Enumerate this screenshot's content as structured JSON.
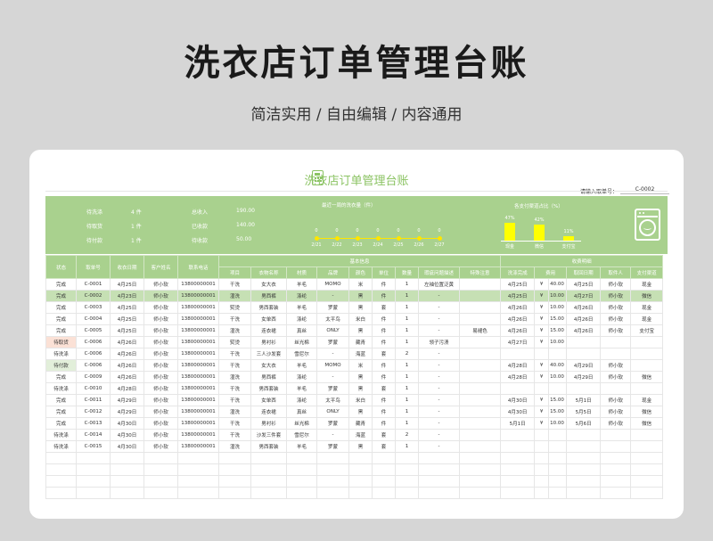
{
  "page": {
    "title": "洗衣店订单管理台账",
    "subtitle": "简洁实用 / 自由编辑 / 内容通用"
  },
  "sheet": {
    "title": "洗衣店订单管理台账",
    "search_label": "请输入取单号：",
    "search_value": "C-0002"
  },
  "dashboard": {
    "stats_left": [
      {
        "label": "待洗涤",
        "value": "4 件"
      },
      {
        "label": "待取货",
        "value": "1 件"
      },
      {
        "label": "待付款",
        "value": "1 件"
      }
    ],
    "stats_mid": [
      {
        "label": "总收入",
        "value": "190.00"
      },
      {
        "label": "已收款",
        "value": "140.00"
      },
      {
        "label": "待收款",
        "value": "50.00"
      }
    ],
    "trend": {
      "title": "最近一周的洗衣量（件）",
      "dates": [
        "2/21",
        "2/22",
        "2/23",
        "2/24",
        "2/25",
        "2/26",
        "2/27"
      ],
      "values": [
        0,
        0,
        0,
        0,
        0,
        0,
        0
      ]
    },
    "payment": {
      "title": "各支付渠道占比（%）",
      "categories": [
        "现金",
        "微信",
        "支付宝"
      ],
      "values": [
        47,
        42,
        11
      ],
      "labels": [
        "47%",
        "42%",
        "11%"
      ],
      "color": "#ffff00"
    },
    "washer_icon": "washing-machine-icon",
    "bg_color": "#a9d18e"
  },
  "table": {
    "group_basic": "基本信息",
    "group_fee": "收费明细",
    "headers": [
      "状态",
      "取单号",
      "收衣日期",
      "客户姓名",
      "联系电话",
      "项目",
      "衣物名称",
      "材质",
      "品牌",
      "颜色",
      "单位",
      "数量",
      "瑕疵问题描述",
      "特殊注意",
      "洗涤完成",
      "费用",
      "取回日期",
      "取件人",
      "支付渠道"
    ],
    "rows": [
      [
        "完成",
        "C-0001",
        "4月25日",
        "师小软",
        "13800000001",
        "干洗",
        "女大衣",
        "羊毛",
        "MOMO",
        "米",
        "件",
        "1",
        "左袖位置泛黄",
        "",
        "4月25日",
        "¥",
        "40.00",
        "4月25日",
        "师小软",
        "现金"
      ],
      [
        "完成",
        "C-0002",
        "4月23日",
        "师小软",
        "13800000001",
        "湿洗",
        "男西裤",
        "涤纶",
        "-",
        "黑",
        "件",
        "1",
        "-",
        "",
        "4月25日",
        "¥",
        "10.00",
        "4月27日",
        "师小软",
        "微信"
      ],
      [
        "完成",
        "C-0003",
        "4月25日",
        "师小软",
        "13800000001",
        "熨烫",
        "男西套装",
        "羊毛",
        "罗蒙",
        "黑",
        "套",
        "1",
        "-",
        "",
        "4月26日",
        "¥",
        "10.00",
        "4月26日",
        "师小软",
        "现金"
      ],
      [
        "完成",
        "C-0004",
        "4月25日",
        "师小软",
        "13800000001",
        "干洗",
        "女单西",
        "涤纶",
        "太平鸟",
        "米白",
        "件",
        "1",
        "-",
        "",
        "4月26日",
        "¥",
        "15.00",
        "4月26日",
        "师小软",
        "现金"
      ],
      [
        "完成",
        "C-0005",
        "4月25日",
        "师小软",
        "13800000001",
        "湿洗",
        "连衣裙",
        "真丝",
        "ONLY",
        "黑",
        "件",
        "1",
        "-",
        "易褪色",
        "4月26日",
        "¥",
        "15.00",
        "4月26日",
        "师小软",
        "支付宝"
      ],
      [
        "待取货",
        "C-0006",
        "4月26日",
        "师小软",
        "13800000001",
        "熨烫",
        "男衬衫",
        "丝光棉",
        "罗蒙",
        "藏青",
        "件",
        "1",
        "领子污渍",
        "",
        "4月27日",
        "¥",
        "10.00",
        "",
        "",
        ""
      ],
      [
        "待洗涤",
        "C-0006",
        "4月26日",
        "师小软",
        "13800000001",
        "干洗",
        "三人沙发套",
        "雪尼尔",
        "-",
        "海蓝",
        "套",
        "2",
        "-",
        "",
        "",
        "",
        "",
        "",
        "",
        ""
      ],
      [
        "待付款",
        "C-0006",
        "4月26日",
        "师小软",
        "13800000001",
        "干洗",
        "女大衣",
        "羊毛",
        "MOMO",
        "米",
        "件",
        "1",
        "-",
        "",
        "4月28日",
        "¥",
        "40.00",
        "4月29日",
        "师小软",
        ""
      ],
      [
        "完成",
        "C-0009",
        "4月26日",
        "师小软",
        "13800000001",
        "湿洗",
        "男西裤",
        "涤纶",
        "-",
        "黑",
        "件",
        "1",
        "-",
        "",
        "4月28日",
        "¥",
        "10.00",
        "4月29日",
        "师小软",
        "微信"
      ],
      [
        "待洗涤",
        "C-0010",
        "4月28日",
        "师小软",
        "13800000001",
        "干洗",
        "男西套装",
        "羊毛",
        "罗蒙",
        "黑",
        "套",
        "1",
        "-",
        "",
        "",
        "",
        "",
        "",
        "",
        ""
      ],
      [
        "完成",
        "C-0011",
        "4月29日",
        "师小软",
        "13800000001",
        "干洗",
        "女单西",
        "涤纶",
        "太平鸟",
        "米白",
        "件",
        "1",
        "-",
        "",
        "4月30日",
        "¥",
        "15.00",
        "5月1日",
        "师小软",
        "现金"
      ],
      [
        "完成",
        "C-0012",
        "4月29日",
        "师小软",
        "13800000001",
        "湿洗",
        "连衣裙",
        "真丝",
        "ONLY",
        "黑",
        "件",
        "1",
        "-",
        "",
        "4月30日",
        "¥",
        "15.00",
        "5月5日",
        "师小软",
        "微信"
      ],
      [
        "完成",
        "C-0013",
        "4月30日",
        "师小软",
        "13800000001",
        "干洗",
        "男衬衫",
        "丝光棉",
        "罗蒙",
        "藏青",
        "件",
        "1",
        "-",
        "",
        "5月1日",
        "¥",
        "10.00",
        "5月6日",
        "师小软",
        "微信"
      ],
      [
        "待洗涤",
        "C-0014",
        "4月30日",
        "师小软",
        "13800000001",
        "干洗",
        "沙发三件套",
        "雪尼尔",
        "-",
        "海蓝",
        "套",
        "2",
        "-",
        "",
        "",
        "",
        "",
        "",
        "",
        ""
      ],
      [
        "待洗涤",
        "C-0015",
        "4月30日",
        "师小软",
        "13800000001",
        "湿洗",
        "男西套装",
        "羊毛",
        "罗蒙",
        "黑",
        "套",
        "1",
        "-",
        "",
        "",
        "",
        "",
        "",
        "",
        ""
      ]
    ],
    "selected_row": 1,
    "empty_rows": 4
  }
}
